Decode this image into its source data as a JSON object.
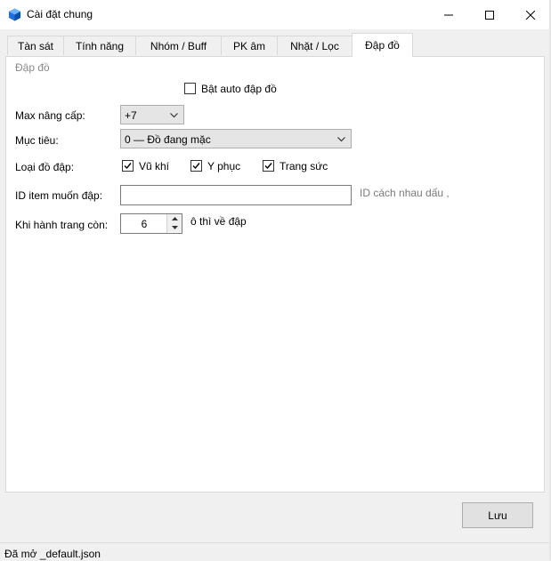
{
  "window": {
    "title": "Cài đặt chung"
  },
  "tabs": [
    {
      "label": "Tàn sát",
      "active": false
    },
    {
      "label": "Tính năng",
      "active": false
    },
    {
      "label": "Nhóm / Buff",
      "active": false
    },
    {
      "label": "PK âm",
      "active": false
    },
    {
      "label": "Nhặt / Lọc",
      "active": false
    },
    {
      "label": "Đập đồ",
      "active": true
    }
  ],
  "group": {
    "title": "Đập đồ",
    "auto_checkbox": {
      "label": "Bật auto đập đồ",
      "checked": false
    }
  },
  "form": {
    "max_level": {
      "label": "Max nâng cấp:",
      "value": "+7"
    },
    "target": {
      "label": "Mục tiêu:",
      "value": "0 — Đồ đang mặc"
    },
    "item_types": {
      "label": "Loại đồ đập:",
      "options": [
        {
          "label": "Vũ khí",
          "checked": true
        },
        {
          "label": "Y phục",
          "checked": true
        },
        {
          "label": "Trang sức",
          "checked": true
        }
      ]
    },
    "item_ids": {
      "label": "ID item muốn đập:",
      "value": "",
      "hint": "ID cách nhau dấu ,"
    },
    "bag_remaining": {
      "label": "Khi hành trang còn:",
      "value": "6",
      "suffix": "ô thì về đập"
    }
  },
  "footer": {
    "save_label": "Lưu",
    "status": "Đã mở _default.json"
  },
  "colors": {
    "accent": "#1e6fd9",
    "chrome": "#f0f0f0",
    "border": "#d9d9d9"
  },
  "icons": {
    "app": "blue-cube-icon",
    "minimize": "minimize-icon",
    "maximize": "maximize-icon",
    "close": "close-icon"
  }
}
